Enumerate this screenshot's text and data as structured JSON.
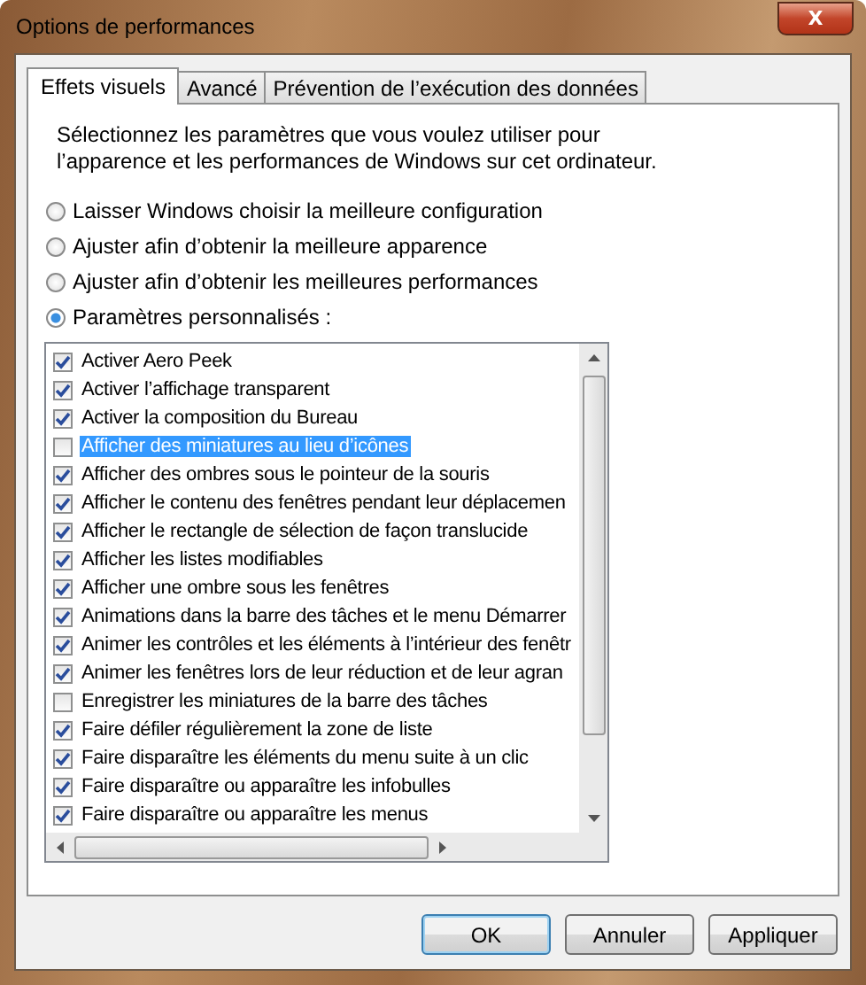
{
  "window": {
    "title": "Options de performances",
    "close": "X"
  },
  "tabs": [
    {
      "label": "Effets visuels",
      "selected": true
    },
    {
      "label": "Avancé",
      "selected": false
    },
    {
      "label": "Prévention de l’exécution des données",
      "selected": false
    }
  ],
  "description": "Sélectionnez les paramètres que vous voulez utiliser pour l’apparence et les performances de Windows sur cet ordinateur.",
  "options": [
    {
      "label": "Laisser Windows choisir la meilleure configuration",
      "selected": false
    },
    {
      "label": "Ajuster afin d’obtenir la meilleure apparence",
      "selected": false
    },
    {
      "label": "Ajuster afin d’obtenir les meilleures performances",
      "selected": false
    },
    {
      "label": "Paramètres personnalisés :",
      "selected": true
    }
  ],
  "effects": [
    {
      "label": "Activer Aero Peek",
      "checked": true,
      "selected": false
    },
    {
      "label": "Activer l’affichage transparent",
      "checked": true,
      "selected": false
    },
    {
      "label": "Activer la composition du Bureau",
      "checked": true,
      "selected": false
    },
    {
      "label": "Afficher des miniatures au lieu d’icônes",
      "checked": false,
      "selected": true
    },
    {
      "label": "Afficher des ombres sous le pointeur de la souris",
      "checked": true,
      "selected": false
    },
    {
      "label": "Afficher le contenu des fenêtres pendant leur déplacemen",
      "checked": true,
      "selected": false
    },
    {
      "label": "Afficher le rectangle de sélection de façon translucide",
      "checked": true,
      "selected": false
    },
    {
      "label": "Afficher les listes modifiables",
      "checked": true,
      "selected": false
    },
    {
      "label": "Afficher une ombre sous les fenêtres",
      "checked": true,
      "selected": false
    },
    {
      "label": "Animations dans la barre des tâches et le menu Démarrer",
      "checked": true,
      "selected": false
    },
    {
      "label": "Animer les contrôles et les éléments à l’intérieur des fenêtr",
      "checked": true,
      "selected": false
    },
    {
      "label": "Animer les fenêtres lors de leur réduction et de leur agran",
      "checked": true,
      "selected": false
    },
    {
      "label": "Enregistrer les miniatures de la barre des tâches",
      "checked": false,
      "selected": false
    },
    {
      "label": "Faire défiler régulièrement la zone de liste",
      "checked": true,
      "selected": false
    },
    {
      "label": "Faire disparaître les éléments du menu suite à un clic",
      "checked": true,
      "selected": false
    },
    {
      "label": "Faire disparaître ou apparaître les infobulles",
      "checked": true,
      "selected": false
    },
    {
      "label": "Faire disparaître ou apparaître les menus",
      "checked": true,
      "selected": false
    }
  ],
  "buttons": [
    {
      "label": "OK",
      "default": true
    },
    {
      "label": "Annuler",
      "default": false
    },
    {
      "label": "Appliquer",
      "default": false
    }
  ]
}
